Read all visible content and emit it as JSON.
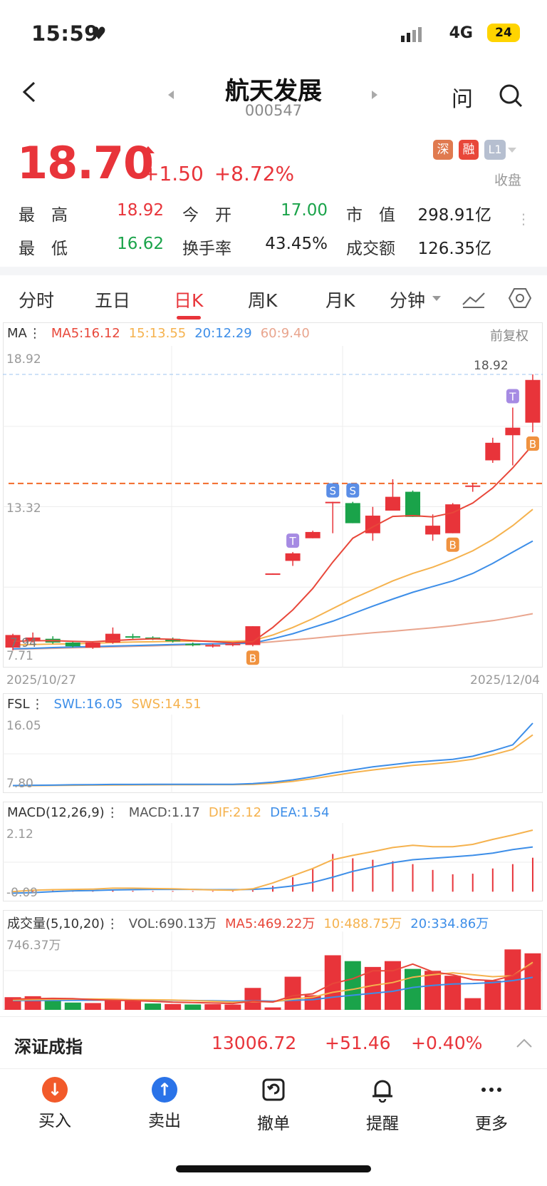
{
  "status": {
    "time": "15:59",
    "network": "4G",
    "battery": "24"
  },
  "header": {
    "title": "航天发展",
    "code": "000547",
    "ask": "问"
  },
  "quote": {
    "price": "18.70",
    "change": "+1.50",
    "change_pct": "+8.72%",
    "tags": [
      "深",
      "融",
      "L1"
    ],
    "closed": "收盘"
  },
  "stats": [
    {
      "label": "最　高",
      "value": "18.92",
      "color": "#e8343a"
    },
    {
      "label": "今　开",
      "value": "17.00",
      "color": "#1aa34a"
    },
    {
      "label": "市　值",
      "value": "298.91亿",
      "color": "#222222"
    },
    {
      "label": "最　低",
      "value": "16.62",
      "color": "#1aa34a"
    },
    {
      "label": "换手率",
      "value": "43.45%",
      "color": "#222222"
    },
    {
      "label": "成交额",
      "value": "126.35亿",
      "color": "#222222"
    }
  ],
  "tabs": [
    "分时",
    "五日",
    "日K",
    "周K",
    "月K",
    "分钟"
  ],
  "active_tab": "日K",
  "colors": {
    "up": "#e8343a",
    "down": "#1aa34a",
    "ma5": "#e8473a",
    "ma15": "#f5b24e",
    "ma20": "#3d8ee8",
    "ma60": "#e9a58e"
  },
  "kline_panel": {
    "legend_name": "MA",
    "ma5": "MA5:16.12",
    "ma15": "15:13.55",
    "ma20": "20:12.29",
    "ma60": "60:9.40",
    "adjust": "前复权",
    "y_top": "18.92",
    "y_mid": "13.32",
    "y_low1": "7.94",
    "y_low2": "7.71",
    "high_marker": "18.92",
    "date_start": "2025/10/27",
    "date_end": "2025/12/04"
  },
  "fsl_panel": {
    "name": "FSL",
    "swl": "SWL:16.05",
    "sws": "SWS:14.51",
    "y_top": "16.05",
    "y_bottom": "7.80"
  },
  "macd_panel": {
    "name": "MACD(12,26,9)",
    "macd": "MACD:1.17",
    "dif": "DIF:2.12",
    "dea": "DEA:1.54",
    "y_top": "2.12",
    "y_bottom": "-0.09"
  },
  "vol_panel": {
    "name": "成交量(5,10,20)",
    "vol": "VOL:690.13万",
    "ma5": "MA5:469.22万",
    "ma10": "10:488.75万",
    "ma20": "20:334.86万",
    "y_top": "746.37万"
  },
  "chart_data": [
    {
      "type": "candlestick",
      "title": "日K",
      "x_range": [
        "2025/10/27",
        "2025/12/04"
      ],
      "ylim": [
        7.71,
        18.92
      ],
      "candles": [
        {
          "o": 8.05,
          "c": 8.55,
          "h": 8.6,
          "l": 7.94
        },
        {
          "o": 8.3,
          "c": 8.45,
          "h": 8.65,
          "l": 8.25
        },
        {
          "o": 8.4,
          "c": 8.25,
          "h": 8.5,
          "l": 8.2
        },
        {
          "o": 8.25,
          "c": 8.1,
          "h": 8.3,
          "l": 8.05
        },
        {
          "o": 8.05,
          "c": 8.25,
          "h": 8.3,
          "l": 8.0
        },
        {
          "o": 8.25,
          "c": 8.6,
          "h": 8.85,
          "l": 8.2
        },
        {
          "o": 8.5,
          "c": 8.45,
          "h": 8.6,
          "l": 8.4
        },
        {
          "o": 8.45,
          "c": 8.4,
          "h": 8.5,
          "l": 8.35
        },
        {
          "o": 8.4,
          "c": 8.3,
          "h": 8.45,
          "l": 8.25
        },
        {
          "o": 8.2,
          "c": 8.15,
          "h": 8.25,
          "l": 8.1
        },
        {
          "o": 8.1,
          "c": 8.15,
          "h": 8.2,
          "l": 8.05
        },
        {
          "o": 8.15,
          "c": 8.2,
          "h": 8.25,
          "l": 8.1
        },
        {
          "o": 8.15,
          "c": 8.9,
          "h": 8.9,
          "l": 8.1
        },
        {
          "o": 10.95,
          "c": 11.0,
          "h": 11.0,
          "l": 10.95
        },
        {
          "o": 11.5,
          "c": 11.8,
          "h": 11.85,
          "l": 11.3
        },
        {
          "o": 12.4,
          "c": 12.65,
          "h": 12.7,
          "l": 12.4
        },
        {
          "o": 13.85,
          "c": 13.85,
          "h": 13.85,
          "l": 12.6
        },
        {
          "o": 13.8,
          "c": 13.0,
          "h": 13.85,
          "l": 13.0
        },
        {
          "o": 12.6,
          "c": 13.3,
          "h": 13.65,
          "l": 12.3
        },
        {
          "o": 13.5,
          "c": 14.05,
          "h": 14.75,
          "l": 13.5
        },
        {
          "o": 14.25,
          "c": 13.25,
          "h": 14.3,
          "l": 13.25
        },
        {
          "o": 12.55,
          "c": 12.9,
          "h": 13.35,
          "l": 12.3
        },
        {
          "o": 12.6,
          "c": 13.75,
          "h": 13.8,
          "l": 12.6
        },
        {
          "o": 14.45,
          "c": 14.5,
          "h": 14.6,
          "l": 14.25
        },
        {
          "o": 15.5,
          "c": 16.2,
          "h": 16.4,
          "l": 15.4
        },
        {
          "o": 16.5,
          "c": 16.8,
          "h": 17.6,
          "l": 15.3
        },
        {
          "o": 17.0,
          "c": 18.7,
          "h": 18.92,
          "l": 16.62
        }
      ],
      "reference_line": 14.58,
      "markers": [
        {
          "index": 12,
          "label": "B",
          "kind": "buy"
        },
        {
          "index": 14,
          "label": "T",
          "kind": "t"
        },
        {
          "index": 16,
          "label": "S",
          "kind": "sell"
        },
        {
          "index": 17,
          "label": "S",
          "kind": "sell"
        },
        {
          "index": 22,
          "label": "B",
          "kind": "buy"
        },
        {
          "index": 25,
          "label": "T",
          "kind": "t"
        },
        {
          "index": 26,
          "label": "B",
          "kind": "buy"
        }
      ],
      "series": [
        {
          "name": "MA5",
          "values": [
            8.3,
            8.32,
            8.33,
            8.3,
            8.28,
            8.33,
            8.37,
            8.4,
            8.38,
            8.33,
            8.29,
            8.24,
            8.28,
            8.85,
            9.55,
            10.4,
            11.45,
            12.4,
            12.85,
            13.27,
            13.3,
            13.25,
            13.42,
            13.8,
            14.4,
            15.2,
            16.12
          ]
        },
        {
          "name": "MA15",
          "values": [
            8.15,
            8.17,
            8.19,
            8.2,
            8.22,
            8.25,
            8.27,
            8.28,
            8.3,
            8.31,
            8.3,
            8.3,
            8.33,
            8.55,
            8.85,
            9.2,
            9.6,
            10.0,
            10.35,
            10.7,
            11.0,
            11.25,
            11.55,
            11.9,
            12.35,
            12.9,
            13.55
          ]
        },
        {
          "name": "MA20",
          "values": [
            8.0,
            8.02,
            8.05,
            8.07,
            8.09,
            8.11,
            8.13,
            8.15,
            8.17,
            8.19,
            8.2,
            8.21,
            8.23,
            8.4,
            8.6,
            8.85,
            9.1,
            9.4,
            9.7,
            9.98,
            10.25,
            10.48,
            10.7,
            11.0,
            11.4,
            11.85,
            12.29
          ]
        },
        {
          "name": "MA60",
          "values": [
            7.98,
            8.0,
            8.02,
            8.04,
            8.06,
            8.08,
            8.1,
            8.12,
            8.14,
            8.16,
            8.18,
            8.2,
            8.22,
            8.28,
            8.35,
            8.42,
            8.5,
            8.57,
            8.64,
            8.7,
            8.77,
            8.84,
            8.92,
            9.02,
            9.12,
            9.25,
            9.4
          ]
        }
      ]
    },
    {
      "type": "line",
      "title": "FSL",
      "ylim": [
        7.8,
        16.05
      ],
      "series": [
        {
          "name": "SWL",
          "values": [
            7.85,
            7.88,
            7.9,
            7.95,
            7.97,
            8.0,
            8.0,
            8.01,
            8.01,
            8.01,
            8.02,
            8.02,
            8.1,
            8.3,
            8.6,
            9.0,
            9.5,
            9.9,
            10.3,
            10.6,
            10.9,
            11.1,
            11.3,
            11.7,
            12.4,
            13.2,
            16.05
          ]
        },
        {
          "name": "SWS",
          "values": [
            7.82,
            7.84,
            7.86,
            7.88,
            7.9,
            7.92,
            7.93,
            7.94,
            7.95,
            7.95,
            7.96,
            7.96,
            8.0,
            8.15,
            8.4,
            8.75,
            9.15,
            9.55,
            9.9,
            10.2,
            10.5,
            10.7,
            10.95,
            11.3,
            11.9,
            12.6,
            14.51
          ]
        }
      ]
    },
    {
      "type": "bar+line",
      "title": "MACD(12,26,9)",
      "ylim": [
        -0.09,
        2.12
      ],
      "bars": [
        0.0,
        0.05,
        0.04,
        0.03,
        0.03,
        0.04,
        0.03,
        0.02,
        0.02,
        0.01,
        0.01,
        0.0,
        0.05,
        0.2,
        0.5,
        0.8,
        1.3,
        1.15,
        1.1,
        1.05,
        0.95,
        0.75,
        0.6,
        0.62,
        0.8,
        0.95,
        1.17
      ],
      "series": [
        {
          "name": "DIF",
          "values": [
            0.0,
            0.05,
            0.07,
            0.08,
            0.09,
            0.12,
            0.12,
            0.11,
            0.1,
            0.08,
            0.06,
            0.05,
            0.1,
            0.3,
            0.55,
            0.8,
            1.1,
            1.25,
            1.38,
            1.52,
            1.6,
            1.55,
            1.55,
            1.63,
            1.8,
            1.95,
            2.12
          ]
        },
        {
          "name": "DEA",
          "values": [
            -0.05,
            -0.03,
            0.0,
            0.03,
            0.04,
            0.06,
            0.07,
            0.08,
            0.08,
            0.08,
            0.07,
            0.07,
            0.08,
            0.12,
            0.2,
            0.32,
            0.5,
            0.7,
            0.85,
            1.0,
            1.1,
            1.15,
            1.2,
            1.25,
            1.33,
            1.45,
            1.54
          ]
        }
      ]
    },
    {
      "type": "bar+line",
      "title": "成交量(5,10,20)",
      "ylim": [
        0,
        746.37
      ],
      "unit": "万",
      "bars": [
        {
          "v": 130,
          "up": true
        },
        {
          "v": 140,
          "up": true
        },
        {
          "v": 95,
          "up": false
        },
        {
          "v": 75,
          "up": false
        },
        {
          "v": 70,
          "up": true
        },
        {
          "v": 110,
          "up": true
        },
        {
          "v": 90,
          "up": true
        },
        {
          "v": 65,
          "up": false
        },
        {
          "v": 60,
          "up": true
        },
        {
          "v": 55,
          "up": false
        },
        {
          "v": 58,
          "up": true
        },
        {
          "v": 55,
          "up": true
        },
        {
          "v": 225,
          "up": true
        },
        {
          "v": 25,
          "up": true
        },
        {
          "v": 340,
          "up": true
        },
        {
          "v": 150,
          "up": true
        },
        {
          "v": 560,
          "up": true
        },
        {
          "v": 500,
          "up": false
        },
        {
          "v": 440,
          "up": true
        },
        {
          "v": 500,
          "up": true
        },
        {
          "v": 420,
          "up": false
        },
        {
          "v": 400,
          "up": true
        },
        {
          "v": 350,
          "up": true
        },
        {
          "v": 120,
          "up": true
        },
        {
          "v": 300,
          "up": true
        },
        {
          "v": 620,
          "up": true
        },
        {
          "v": 580,
          "up": true
        }
      ],
      "series": [
        {
          "name": "MA5",
          "values": [
            110,
            115,
            118,
            115,
            105,
            98,
            95,
            88,
            78,
            75,
            70,
            65,
            90,
            80,
            145,
            165,
            270,
            320,
            400,
            400,
            470,
            390,
            360,
            310,
            300,
            350,
            469
          ]
        },
        {
          "name": "MA10",
          "values": [
            100,
            105,
            108,
            110,
            112,
            110,
            105,
            103,
            100,
            95,
            88,
            80,
            85,
            82,
            110,
            130,
            180,
            210,
            250,
            280,
            335,
            360,
            380,
            360,
            340,
            350,
            488
          ]
        },
        {
          "name": "MA20",
          "values": [
            95,
            96,
            97,
            98,
            99,
            100,
            101,
            100,
            98,
            96,
            94,
            90,
            92,
            90,
            98,
            104,
            130,
            150,
            170,
            190,
            230,
            250,
            265,
            270,
            280,
            300,
            334
          ]
        }
      ]
    }
  ],
  "index_bar": {
    "name": "深证成指",
    "value": "13006.72",
    "change": "+51.46",
    "change_pct": "+0.40%"
  },
  "bottom_bar": [
    {
      "label": "买入",
      "icon": "arrow-down-icon"
    },
    {
      "label": "卖出",
      "icon": "arrow-up-icon"
    },
    {
      "label": "撤单",
      "icon": "undo-order-icon"
    },
    {
      "label": "提醒",
      "icon": "bell-icon"
    },
    {
      "label": "更多",
      "icon": "more-icon"
    }
  ]
}
